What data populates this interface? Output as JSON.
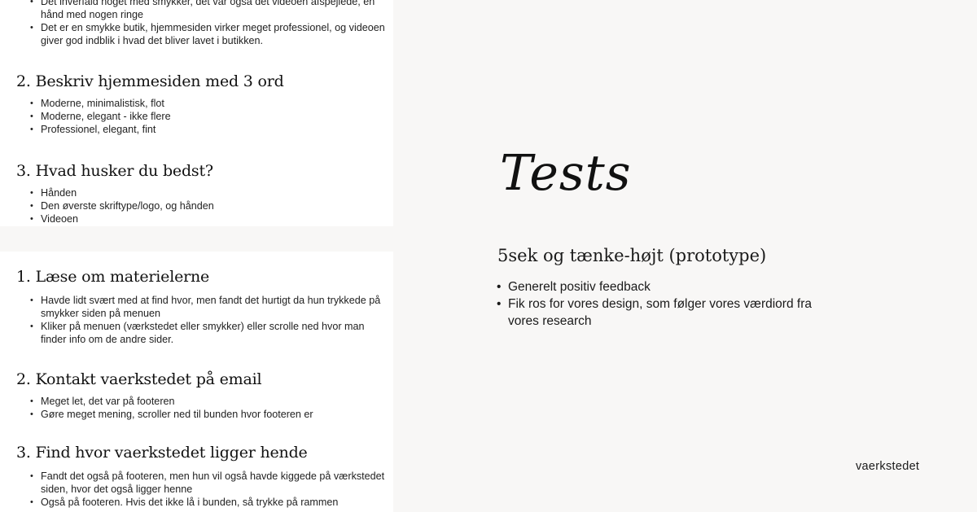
{
  "top_panel": {
    "intro_bullets": [
      "Det ihverfald noget med smykker, det var også det videoen afspejlede, en hånd med nogen ringe",
      "Det er en smykke butik, hjemmesiden virker meget professionel, og videoen giver god indblik i hvad det bliver lavet i butikken."
    ],
    "sections": [
      {
        "title": "2. Beskriv hjemmesiden med 3 ord",
        "bullets": [
          "Moderne, minimalistisk, flot",
          "Moderne, elegant - ikke flere",
          "Professionel, elegant, fint"
        ]
      },
      {
        "title": "3. Hvad husker du bedst?",
        "bullets": [
          "Hånden",
          "Den øverste skriftype/logo, og hånden",
          "Videoen"
        ]
      }
    ]
  },
  "bottom_panel": {
    "sections": [
      {
        "title": "1. Læse om materielerne",
        "bullets": [
          "Havde lidt svært med at find hvor, men fandt det hurtigt da hun trykkede på smykker siden på menuen",
          "Kliker på menuen (værkstedet eller smykker) eller scrolle ned hvor man finder info om de andre sider."
        ]
      },
      {
        "title": "2. Kontakt vaerkstedet på email",
        "bullets": [
          "Meget let, det var på footeren",
          "Gøre meget mening, scroller ned til bunden hvor footeren er"
        ]
      },
      {
        "title": "3. Find hvor vaerkstedet ligger hende",
        "bullets": [
          "Fandt det også på footeren, men hun vil også havde kiggede på værkstedet siden, hvor det også ligger henne",
          "Også på footeren. Hvis det ikke lå i bunden, så trykke på rammen"
        ]
      }
    ]
  },
  "main": {
    "title": "Tests",
    "subheading": "5sek og tænke-højt (prototype)",
    "feedback": [
      "Generelt positiv feedback",
      "Fik ros for vores design, som følger vores værdiord fra vores research"
    ],
    "brand": "vaerkstedet"
  },
  "colors": {
    "background": "#f8f7f6",
    "panel": "#ffffff",
    "text": "#1a1a1a"
  }
}
